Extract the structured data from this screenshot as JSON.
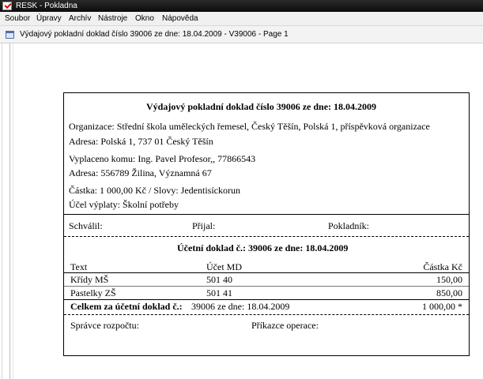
{
  "window": {
    "title": "RESK  - Pokladna"
  },
  "menu": {
    "items": [
      "Soubor",
      "Úpravy",
      "Archív",
      "Nástroje",
      "Okno",
      "Nápověda"
    ]
  },
  "document": {
    "title": "Výdajový pokladní doklad číslo 39006 ze dne: 18.04.2009 - V39006 - Page 1"
  },
  "voucher": {
    "heading": "Výdajový pokladní doklad číslo 39006 ze dne: 18.04.2009",
    "organization": "Organizace: Střední škola uměleckých řemesel, Český Těšín, Polská 1, příspěvková organizace",
    "address": "Adresa: Polská 1, 737 01 Český Těšín",
    "paid_to": "Vyplaceno komu: Ing. Pavel Profesor,, 77866543",
    "paid_to_address": "Adresa: 556789 Žilina, Významná 67",
    "amount": "Částka: 1 000,00 Kč / Slovy: Jedentisíckorun",
    "purpose": "Účel výplaty: Školní potřeby",
    "signatures": {
      "approved": "Schválil:",
      "received": "Přijal:",
      "cashier": "Pokladník:"
    },
    "accounting": {
      "heading": "Účetní doklad č.: 39006 ze dne: 18.04.2009",
      "columns": {
        "text": "Text",
        "account": "Účet MD",
        "amount": "Částka Kč"
      },
      "rows": [
        {
          "text": "Křídy MŠ",
          "account": "501 40",
          "amount": "150,00"
        },
        {
          "text": "Pastelky ZŠ",
          "account": "501 41",
          "amount": "850,00"
        }
      ],
      "total": {
        "label": "Celkem za účetní doklad č.:",
        "ref": "39006 ze dne: 18.04.2009",
        "amount": "1 000,00 *"
      }
    },
    "footer": {
      "budget_admin": "Správce rozpočtu:",
      "operation_order": "Příkazce operace:"
    }
  }
}
